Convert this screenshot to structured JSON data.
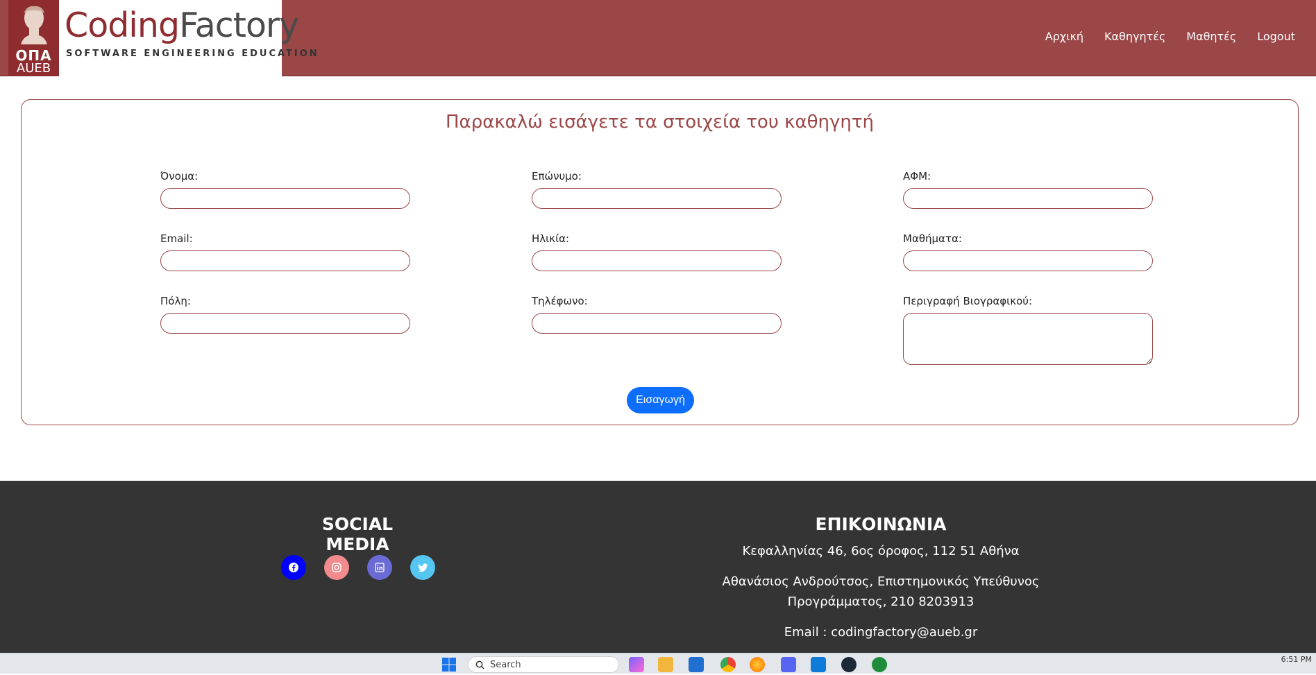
{
  "header": {
    "logo": {
      "mark_line1": "ΟΠΑ",
      "mark_line2": "AUEB",
      "title_part1": "Coding",
      "title_part2": "Factory",
      "subtitle": "SOFTWARE ENGINEERING EDUCATION"
    },
    "nav": [
      {
        "label": "Αρχική"
      },
      {
        "label": "Καθηγητές"
      },
      {
        "label": "Μαθητές"
      },
      {
        "label": "Logout"
      }
    ]
  },
  "form": {
    "title": "Παρακαλώ εισάγετε τα στοιχεία του καθηγητή",
    "fields": {
      "first_name": {
        "label": "Όνομα:",
        "value": ""
      },
      "last_name": {
        "label": "Επώνυμο:",
        "value": ""
      },
      "afm": {
        "label": "ΑΦΜ:",
        "value": ""
      },
      "email": {
        "label": "Email:",
        "value": ""
      },
      "age": {
        "label": "Ηλικία:",
        "value": ""
      },
      "courses": {
        "label": "Μαθήματα:",
        "value": ""
      },
      "city": {
        "label": "Πόλη:",
        "value": ""
      },
      "phone": {
        "label": "Τηλέφωνο:",
        "value": ""
      },
      "bio": {
        "label": "Περιγραφή Βιογραφικού:",
        "value": ""
      }
    },
    "submit_label": "Εισαγωγή"
  },
  "footer": {
    "social_title": "SOCIAL MEDIA",
    "social_icons": [
      {
        "icon": "facebook-icon",
        "color": "#0000ff"
      },
      {
        "icon": "instagram-icon",
        "color": "#f28b8b"
      },
      {
        "icon": "linkedin-icon",
        "color": "#6b6bd6"
      },
      {
        "icon": "twitter-icon",
        "color": "#55c6f2"
      }
    ],
    "contact_title": "ΕΠΙΚΟΙΝΩΝΙΑ",
    "address": "Κεφαλληνίας 46, 6ος όροφος, 112 51 Αθήνα",
    "person_line1": "Αθανάσιος Ανδρούτσος, Επιστημονικός Υπεύθυνος",
    "person_line2": "Προγράμματος, 210 8203913",
    "email": "Email : codingfactory@aueb.gr"
  },
  "taskbar": {
    "search_placeholder": "Search",
    "time": "6:51 PM"
  },
  "colors": {
    "brand": "#9b4647",
    "primary_button": "#0d6efd",
    "footer_bg": "#343434"
  }
}
